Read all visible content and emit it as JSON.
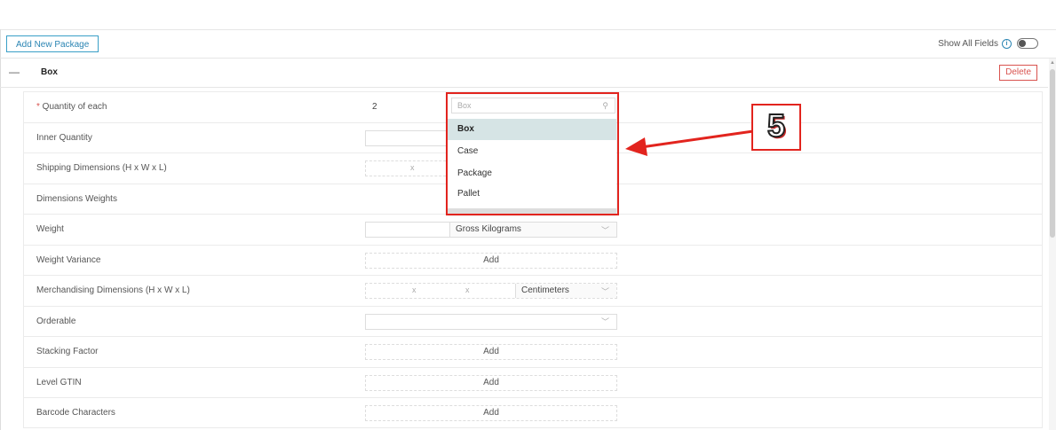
{
  "toolbar": {
    "add_package_label": "Add New Package",
    "show_all_label": "Show All Fields",
    "info_glyph": "i"
  },
  "section": {
    "collapse_glyph": "—",
    "title": "Box",
    "delete_label": "Delete"
  },
  "rows": [
    {
      "label": "Quantity of each",
      "required_mark": "* ",
      "value": "2"
    },
    {
      "label": "Inner Quantity"
    },
    {
      "label": "Shipping Dimensions (H x W x L)",
      "sep": "x"
    },
    {
      "label": "Dimensions Weights"
    },
    {
      "label": "Weight",
      "unit": "Gross Kilograms"
    },
    {
      "label": "Weight Variance",
      "action": "Add"
    },
    {
      "label": "Merchandising Dimensions (H x W x L)",
      "sep1": "x",
      "sep2": "x",
      "unit": "Centimeters"
    },
    {
      "label": "Orderable"
    },
    {
      "label": "Stacking Factor",
      "action": "Add"
    },
    {
      "label": "Level GTIN",
      "action": "Add"
    },
    {
      "label": "Barcode Characters",
      "action": "Add"
    }
  ],
  "dropdown": {
    "search_placeholder": "Box",
    "options": [
      "Box",
      "Case",
      "Package",
      "Pallet"
    ],
    "selected": "Box"
  },
  "callout": {
    "step_number": "5"
  },
  "icons": {
    "search": "magnifier-icon",
    "chevron": "chevron-down-icon"
  },
  "colors": {
    "accent": "#2b85b3",
    "danger": "#d9534f",
    "highlight": "#e2241e",
    "selected_bg": "#d6e4e5"
  }
}
